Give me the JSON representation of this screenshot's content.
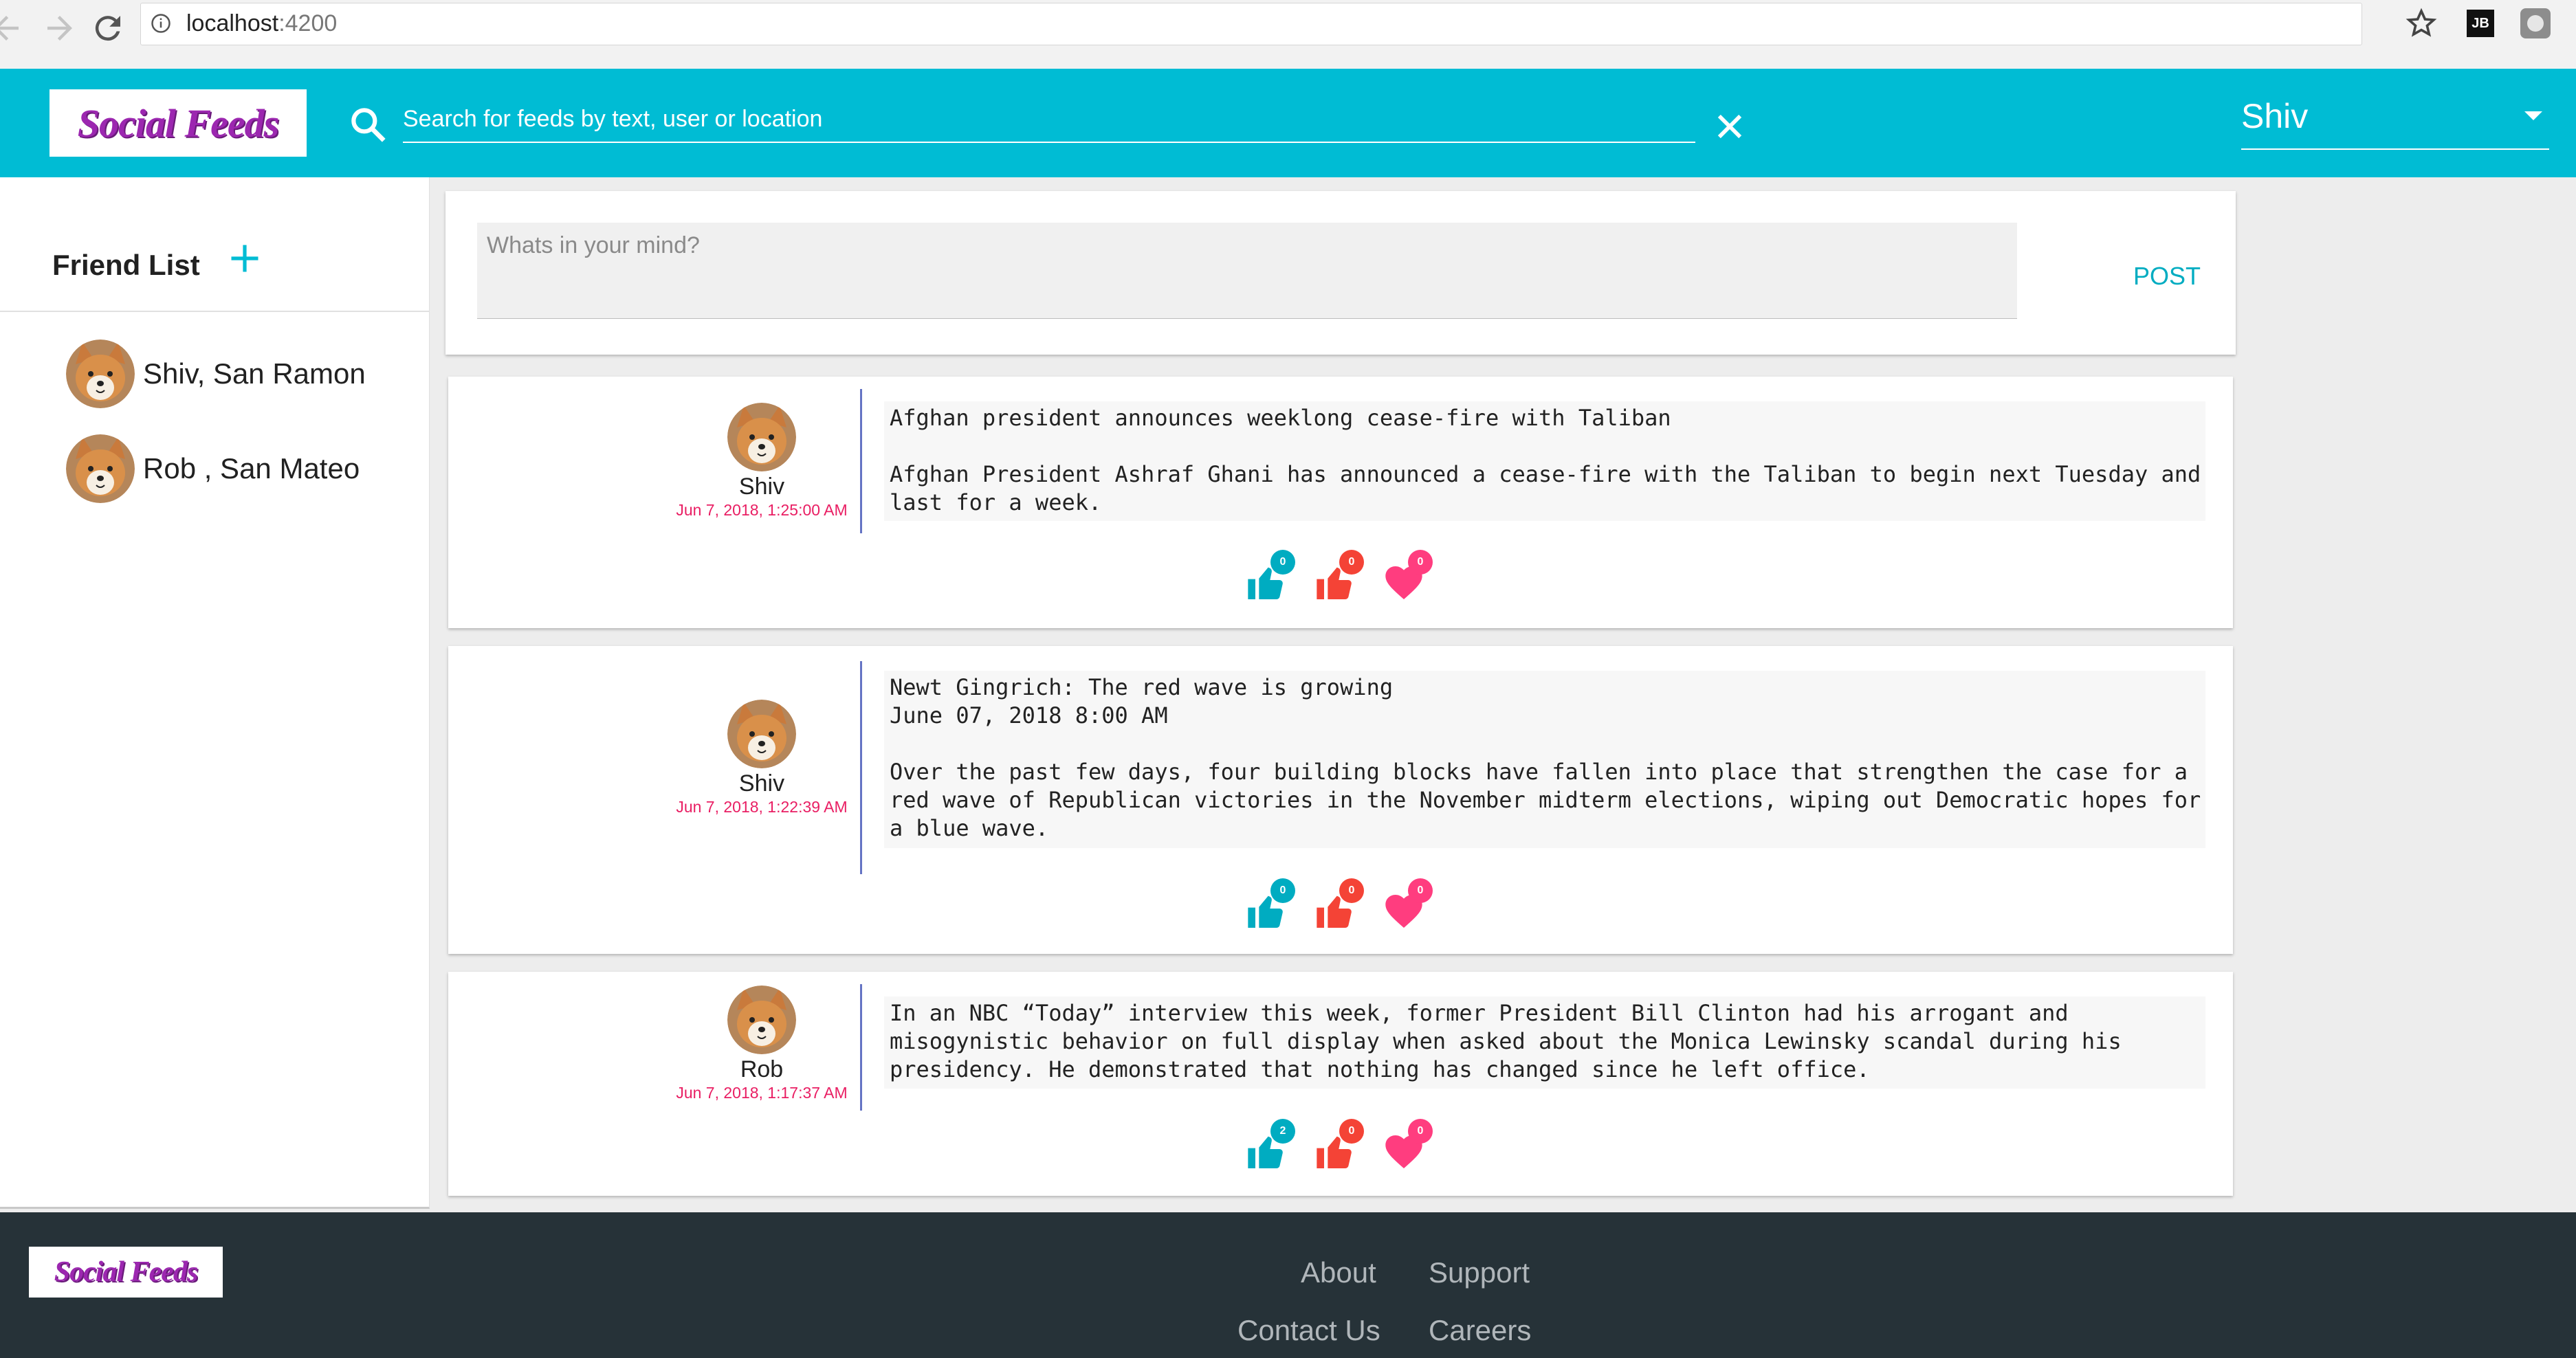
{
  "browser": {
    "url_host": "localhost",
    "url_port": ":4200",
    "extension_label": "JB"
  },
  "header": {
    "logo": "Social Feeds",
    "search_placeholder": "Search for feeds by text, user or location",
    "current_user": "Shiv",
    "accent_color": "#00bcd4"
  },
  "sidebar": {
    "title": "Friend List",
    "friends": [
      {
        "label": "Shiv, San Ramon"
      },
      {
        "label": "Rob , San Mateo"
      }
    ]
  },
  "composer": {
    "placeholder": "Whats in your mind?",
    "post_label": "POST"
  },
  "feeds": [
    {
      "user": "Shiv",
      "time": "Jun 7, 2018, 1:25:00 AM",
      "text": "Afghan president announces weeklong cease-fire with Taliban\n\nAfghan President Ashraf Ghani has announced a cease-fire with the Taliban to begin next Tuesday and\nlast for a week.",
      "likes": "0",
      "dislikes": "0",
      "hearts": "0"
    },
    {
      "user": "Shiv",
      "time": "Jun 7, 2018, 1:22:39 AM",
      "text": "Newt Gingrich: The red wave is growing\nJune 07, 2018 8:00 AM\n\nOver the past few days, four building blocks have fallen into place that strengthen the case for a\nred wave of Republican victories in the November midterm elections, wiping out Democratic hopes for\na blue wave.",
      "likes": "0",
      "dislikes": "0",
      "hearts": "0"
    },
    {
      "user": "Rob",
      "time": "Jun 7, 2018, 1:17:37 AM",
      "text": "In an NBC “Today” interview this week, former President Bill Clinton had his arrogant and\nmisogynistic behavior on full display when asked about the Monica Lewinsky scandal during his\npresidency. He demonstrated that nothing has changed since he left office.",
      "likes": "2",
      "dislikes": "0",
      "hearts": "0"
    }
  ],
  "footer": {
    "logo": "Social Feeds",
    "links": [
      "About",
      "Support",
      "Contact Us",
      "Careers"
    ]
  }
}
